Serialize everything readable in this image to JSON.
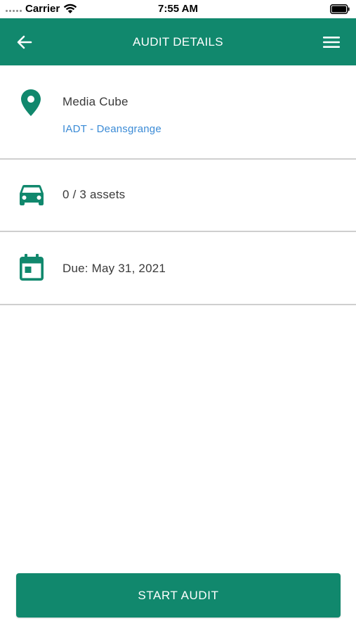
{
  "status_bar": {
    "carrier": "Carrier",
    "time": "7:55 AM"
  },
  "app_bar": {
    "title": "AUDIT DETAILS",
    "back_icon": "arrow-left-icon",
    "menu_icon": "hamburger-menu-icon"
  },
  "details": {
    "location": {
      "icon": "map-pin-icon",
      "name": "Media Cube",
      "site": "IADT - Deansgrange"
    },
    "assets": {
      "icon": "car-icon",
      "label": "0 / 3 assets"
    },
    "due": {
      "icon": "calendar-icon",
      "label": "Due: May 31, 2021"
    }
  },
  "actions": {
    "start_label": "START AUDIT"
  },
  "colors": {
    "primary": "#11886d",
    "link": "#3b8bd6",
    "divider": "#cfcfcf",
    "text": "#3a3a3a"
  }
}
